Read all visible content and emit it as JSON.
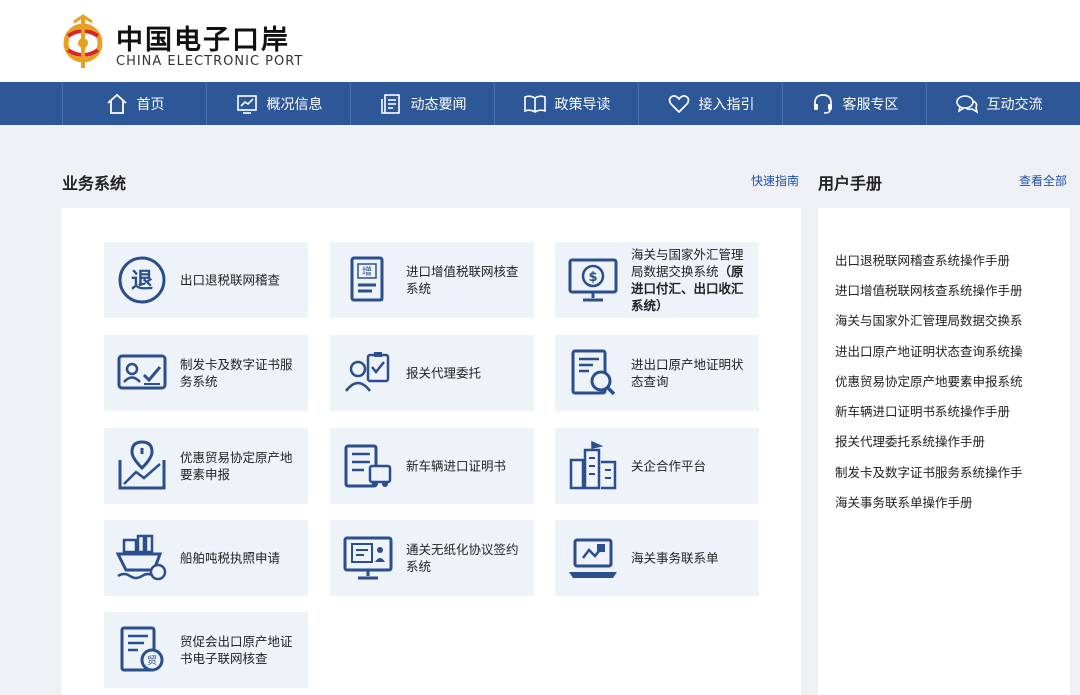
{
  "header": {
    "logo_cn": "中国电子口岸",
    "logo_en": "CHINA ELECTRONIC PORT",
    "logo_icon": "customs-emblem-icon"
  },
  "nav": {
    "items": [
      {
        "label": "首页",
        "icon": "home-icon"
      },
      {
        "label": "概况信息",
        "icon": "chart-icon"
      },
      {
        "label": "动态要闻",
        "icon": "news-icon"
      },
      {
        "label": "政策导读",
        "icon": "book-icon"
      },
      {
        "label": "接入指引",
        "icon": "heart-icon"
      },
      {
        "label": "客服专区",
        "icon": "headset-icon"
      },
      {
        "label": "互动交流",
        "icon": "chat-icon"
      }
    ]
  },
  "business": {
    "title": "业务系统",
    "link": "快速指南",
    "cards": [
      {
        "label": "出口退税联网稽查",
        "icon": "tax-refund-icon"
      },
      {
        "label": "进口增值税联网核查系统",
        "icon": "vat-document-icon"
      },
      {
        "label": "海关与国家外汇管理局数据交换系统",
        "label_bold": "（原进口付汇、出口收汇系统）",
        "icon": "currency-monitor-icon"
      },
      {
        "label": "制发卡及数字证书服务系统",
        "icon": "id-card-icon"
      },
      {
        "label": "报关代理委托",
        "icon": "agent-clipboard-icon"
      },
      {
        "label": "进出口原产地证明状态查询",
        "icon": "document-search-icon"
      },
      {
        "label": "优惠贸易协定原产地要素申报",
        "icon": "map-pin-icon"
      },
      {
        "label": "新车辆进口证明书",
        "icon": "vehicle-document-icon"
      },
      {
        "label": "关企合作平台",
        "icon": "buildings-icon"
      },
      {
        "label": "船舶吨税执照申请",
        "icon": "ship-icon"
      },
      {
        "label": "通关无纸化协议签约系统",
        "icon": "paperless-monitor-icon"
      },
      {
        "label": "海关事务联系单",
        "icon": "laptop-icon"
      },
      {
        "label": "贸促会出口原产地证书电子联网核查",
        "icon": "certificate-icon"
      }
    ]
  },
  "manuals": {
    "title": "用户手册",
    "link": "查看全部",
    "items": [
      "出口退税联网稽查系统操作手册",
      "进口增值税联网核查系统操作手册",
      "海关与国家外汇管理局数据交换系",
      "进出口原产地证明状态查询系统操",
      "优惠贸易协定原产地要素申报系统",
      "新车辆进口证明书系统操作手册",
      "报关代理委托系统操作手册",
      "制发卡及数字证书服务系统操作手",
      "海关事务联系单操作手册"
    ]
  },
  "colors": {
    "nav_bg": "#2d5797",
    "card_bg": "#eef2f9",
    "icon_stroke": "#2b4f8e",
    "link": "#1e4fa8",
    "page_bg": "#eef0f3"
  }
}
